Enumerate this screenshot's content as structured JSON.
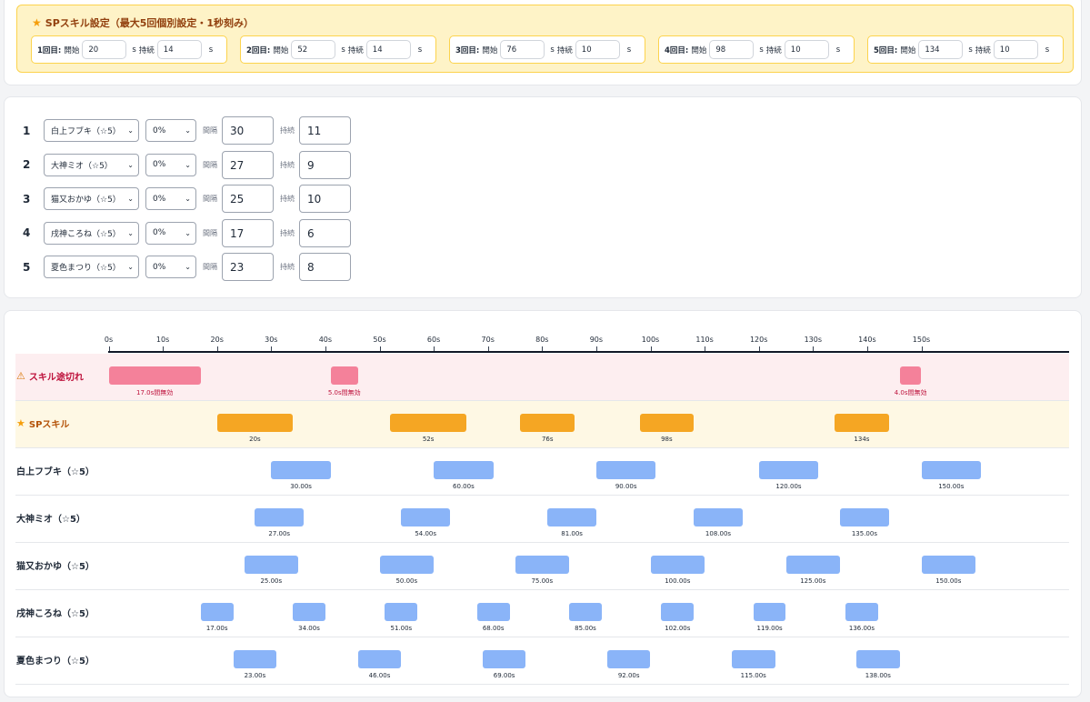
{
  "sp_settings": {
    "title": "SPスキル設定（最大5回個別設定・1秒刻み）",
    "start_label": "開始",
    "duration_label": "持続",
    "unit": "s",
    "slots": [
      {
        "label": "1回目:",
        "start": "20",
        "duration": "14"
      },
      {
        "label": "2回目:",
        "start": "52",
        "duration": "14"
      },
      {
        "label": "3回目:",
        "start": "76",
        "duration": "10"
      },
      {
        "label": "4回目:",
        "start": "98",
        "duration": "10"
      },
      {
        "label": "5回目:",
        "start": "134",
        "duration": "10"
      }
    ]
  },
  "members": {
    "interval_label": "間隔",
    "duration_label": "持続",
    "rows": [
      {
        "num": "1",
        "name": "白上フブキ（☆5）",
        "rate": "0%",
        "interval": "30",
        "duration": "11"
      },
      {
        "num": "2",
        "name": "大神ミオ（☆5）",
        "rate": "0%",
        "interval": "27",
        "duration": "9"
      },
      {
        "num": "3",
        "name": "猫又おかゆ（☆5）",
        "rate": "0%",
        "interval": "25",
        "duration": "10"
      },
      {
        "num": "4",
        "name": "戌神ころね（☆5）",
        "rate": "0%",
        "interval": "17",
        "duration": "6"
      },
      {
        "num": "5",
        "name": "夏色まつり（☆5）",
        "rate": "0%",
        "interval": "23",
        "duration": "8"
      }
    ]
  },
  "timeline": {
    "ticks": [
      "0s",
      "10s",
      "20s",
      "30s",
      "40s",
      "50s",
      "60s",
      "70s",
      "80s",
      "90s",
      "100s",
      "110s",
      "120s",
      "130s",
      "140s",
      "150s"
    ],
    "gap_lane": {
      "label": "スキル途切れ",
      "color": "#f4819a",
      "bg": "#fdeef0",
      "gaps": [
        {
          "start": 0,
          "len": 17.0,
          "label": "17.0s間無効"
        },
        {
          "start": 41,
          "len": 5.0,
          "label": "5.0s間無効"
        },
        {
          "start": 146,
          "len": 4.0,
          "label": "4.0s間無効"
        }
      ]
    },
    "sp_lane": {
      "label": "SPスキル",
      "color": "#f5a623",
      "bg": "#fef8e4",
      "bars": [
        {
          "start": 20,
          "len": 14,
          "label": "20s"
        },
        {
          "start": 52,
          "len": 14,
          "label": "52s"
        },
        {
          "start": 76,
          "len": 10,
          "label": "76s"
        },
        {
          "start": 98,
          "len": 10,
          "label": "98s"
        },
        {
          "start": 134,
          "len": 10,
          "label": "134s"
        }
      ]
    },
    "member_color": "#8ab4f8",
    "member_lanes": [
      {
        "label": "白上フブキ（☆5）",
        "duration": 11,
        "starts": [
          30,
          60,
          90,
          120,
          150
        ],
        "labels": [
          "30.00s",
          "60.00s",
          "90.00s",
          "120.00s",
          "150.00s"
        ]
      },
      {
        "label": "大神ミオ（☆5）",
        "duration": 9,
        "starts": [
          27,
          54,
          81,
          108,
          135
        ],
        "labels": [
          "27.00s",
          "54.00s",
          "81.00s",
          "108.00s",
          "135.00s"
        ]
      },
      {
        "label": "猫又おかゆ（☆5）",
        "duration": 10,
        "starts": [
          25,
          50,
          75,
          100,
          125,
          150
        ],
        "labels": [
          "25.00s",
          "50.00s",
          "75.00s",
          "100.00s",
          "125.00s",
          "150.00s"
        ]
      },
      {
        "label": "戌神ころね（☆5）",
        "duration": 6,
        "starts": [
          17,
          34,
          51,
          68,
          85,
          102,
          119,
          136
        ],
        "labels": [
          "17.00s",
          "34.00s",
          "51.00s",
          "68.00s",
          "85.00s",
          "102.00s",
          "119.00s",
          "136.00s"
        ]
      },
      {
        "label": "夏色まつり（☆5）",
        "duration": 8,
        "starts": [
          23,
          46,
          69,
          92,
          115,
          138
        ],
        "labels": [
          "23.00s",
          "46.00s",
          "69.00s",
          "92.00s",
          "115.00s",
          "138.00s"
        ]
      }
    ]
  }
}
